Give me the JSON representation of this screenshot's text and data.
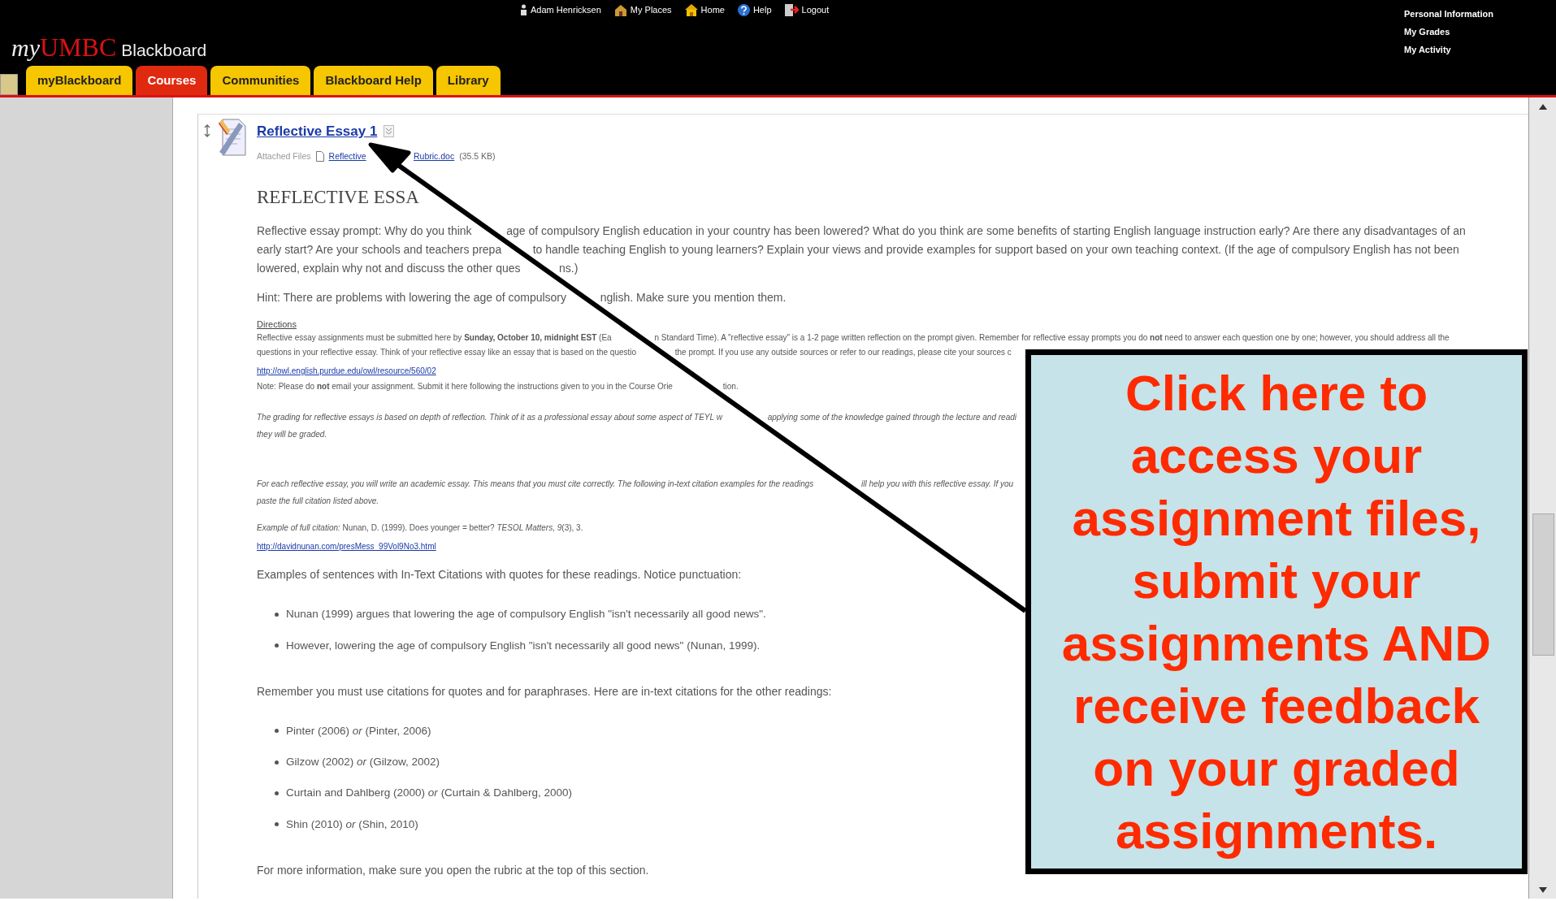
{
  "header": {
    "user_links": [
      {
        "kind": "person",
        "label": "Adam Henricksen"
      },
      {
        "kind": "places",
        "label": "My Places"
      },
      {
        "kind": "home",
        "label": "Home"
      },
      {
        "kind": "help",
        "label": "Help"
      },
      {
        "kind": "logout",
        "label": "Logout"
      }
    ],
    "logo": {
      "prefix": "my",
      "brand": "UMBC",
      "product": "Blackboard"
    },
    "side_links": [
      "Personal Information",
      "My Grades",
      "My Activity"
    ]
  },
  "tabs": [
    {
      "label": "myBlackboard",
      "selected": false
    },
    {
      "label": "Courses",
      "selected": true
    },
    {
      "label": "Communities",
      "selected": false
    },
    {
      "label": "Blackboard Help",
      "selected": false
    },
    {
      "label": "Library",
      "selected": false
    }
  ],
  "item": {
    "title": "Reflective Essay 1",
    "attached_label": "Attached Files",
    "attachment": {
      "name_parts": [
        "Reflective",
        "Rubric.doc"
      ],
      "size": "(35.5 KB)"
    }
  },
  "body": [
    {
      "kind": "heading",
      "lines": [
        [
          "REFLECTIVE ESSA"
        ]
      ]
    },
    {
      "kind": "prompt",
      "lines": [
        [
          "Reflective essay prompt: Why do you think",
          "age of compulsory English education in your country has been lowered? What do you think are some benefits of starting English language instruction early? Are there any disadvantages of an"
        ],
        [
          "early start? Are your schools and teachers prepa",
          "to handle teaching English to young learners? Explain your views and provide examples for support based on your own teaching context. (If the age of compulsory English has not been"
        ],
        [
          "lowered, explain why not and discuss the other ques",
          "ns.)"
        ]
      ]
    },
    {
      "kind": "prompt",
      "lines": [
        [
          "Hint: There are problems with lowering the age of compulsory",
          "nglish. Make sure you mention them."
        ]
      ]
    },
    {
      "kind": "label",
      "text": "Directions"
    },
    {
      "kind": "small",
      "lines": [
        [
          "Reflective essay assignments must be submitted here by **Sunday, October 10, midnight EST** (Ea",
          "n Standard Time). A \"reflective essay\" is a 1-2 page written reflection on the prompt given. Remember for reflective essay prompts you do **not** need to answer each question one by one; however, you should address all the"
        ],
        [
          "questions in your reflective essay. Think of your reflective essay like an essay that is based on the questio",
          "the prompt. If you use any outside sources or refer to our readings, please cite your sources c"
        ]
      ]
    },
    {
      "kind": "small-link",
      "text": "http://owl.english.purdue.edu/owl/resource/560/02"
    },
    {
      "kind": "small",
      "lines": [
        [
          "Note: Please do **not** email your assignment. Submit it here following the instructions given to you in the Course Orie",
          "tion."
        ]
      ]
    },
    {
      "kind": "italic",
      "lines": [
        [
          "The grading for reflective essays is based on depth of reflection. Think of it as a professional essay about some aspect of TEYL w",
          "applying some of the knowledge gained through the lecture and readi"
        ],
        [
          "they will be graded."
        ]
      ]
    },
    {
      "kind": "italic-far",
      "lines": [
        [
          "For each reflective essay, you will write an academic essay. This means that you must cite correctly. The following in-text citation examples for the readings",
          "ill help you with this reflective essay. If you"
        ],
        [
          "paste the full citation listed above."
        ]
      ]
    },
    {
      "kind": "small",
      "lines": [
        [
          "*Example of full citation:* Nunan, D. (1999). Does younger = better? *TESOL Matters, 9*(3), 3."
        ]
      ]
    },
    {
      "kind": "small-link",
      "text": "http://davidnunan.com/presMess_99Vol9No3.html"
    },
    {
      "kind": "body",
      "text": "Examples of sentences with In-Text Citations with quotes for these readings. Notice punctuation:"
    },
    {
      "kind": "bullets",
      "items": [
        "Nunan (1999) argues that lowering the age of compulsory English \"isn't necessarily all good news\".",
        "However, lowering the age of compulsory English \"isn't necessarily all good news\" (Nunan, 1999)."
      ]
    },
    {
      "kind": "body",
      "text": "Remember you must use citations for quotes and for paraphrases. Here are in-text citations for the other readings:"
    },
    {
      "kind": "bullets",
      "items": [
        "Pinter (2006) *or* (Pinter, 2006)",
        "Gilzow (2002) *or* (Gilzow, 2002)",
        "Curtain and Dahlberg (2000) *or* (Curtain & Dahlberg, 2000)",
        "Shin (2010) *or* (Shin, 2010)"
      ]
    },
    {
      "kind": "body",
      "text": "For more information, make sure you open the rubric at the top of this section."
    }
  ],
  "callout": {
    "text": "Click here to\naccess your\nassignment files,\nsubmit your\nassignments AND\nreceive feedback\non your graded\nassignments."
  }
}
